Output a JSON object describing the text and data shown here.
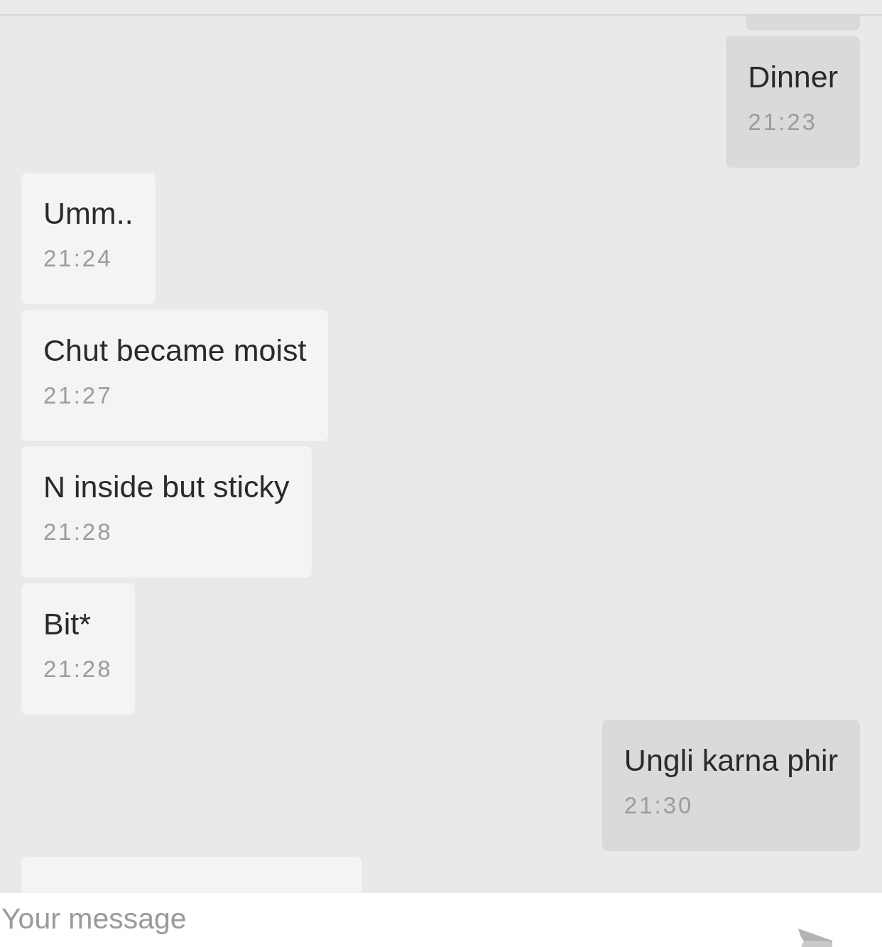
{
  "messages": [
    {
      "kind": "outgoing"
    },
    {
      "kind": "outgoing",
      "text": "Dinner",
      "time": "21:23"
    },
    {
      "kind": "incoming",
      "text": "Umm..",
      "time": "21:24"
    },
    {
      "kind": "incoming",
      "text": "Chut became moist",
      "time": "21:27"
    },
    {
      "kind": "incoming",
      "text": "N inside but sticky",
      "time": "21:28"
    },
    {
      "kind": "incoming",
      "text": "Bit*",
      "time": "21:28"
    },
    {
      "kind": "outgoing",
      "text": "Ungli karna phir",
      "time": "21:30"
    },
    {
      "kind": "incoming"
    }
  ],
  "composer": {
    "placeholder": "Your message"
  }
}
